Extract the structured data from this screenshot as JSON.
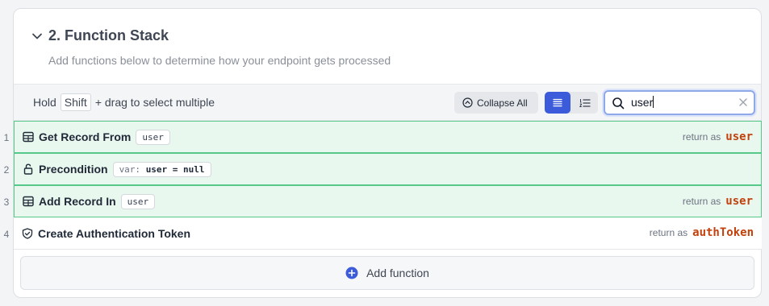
{
  "section": {
    "title": "2. Function Stack",
    "subtitle": "Add functions below to determine how your endpoint gets processed"
  },
  "toolbar": {
    "hint_prefix": "Hold",
    "hint_key": "Shift",
    "hint_suffix": "+ drag to select multiple",
    "collapse_label": "Collapse All",
    "search_value": "user"
  },
  "functions": [
    {
      "num": "1",
      "icon": "table-icon",
      "name": "Get Record From",
      "chip": "user",
      "return_label": "return as",
      "return_var": "user",
      "highlighted": true
    },
    {
      "num": "2",
      "icon": "lock-icon",
      "name": "Precondition",
      "chip_prefix": "var:",
      "chip_expr": "user = null",
      "highlighted": true
    },
    {
      "num": "3",
      "icon": "table-icon",
      "name": "Add Record In",
      "chip": "user",
      "return_label": "return as",
      "return_var": "user",
      "highlighted": true
    },
    {
      "num": "4",
      "icon": "shield-check-icon",
      "name": "Create Authentication Token",
      "return_label": "return as",
      "return_var": "authToken",
      "highlighted": false
    }
  ],
  "add_function_label": "Add function",
  "colors": {
    "accent": "#3b5bdb",
    "highlight_bg": "#e9f8ef",
    "highlight_border": "#56c98a",
    "return_var": "#c2410c"
  }
}
